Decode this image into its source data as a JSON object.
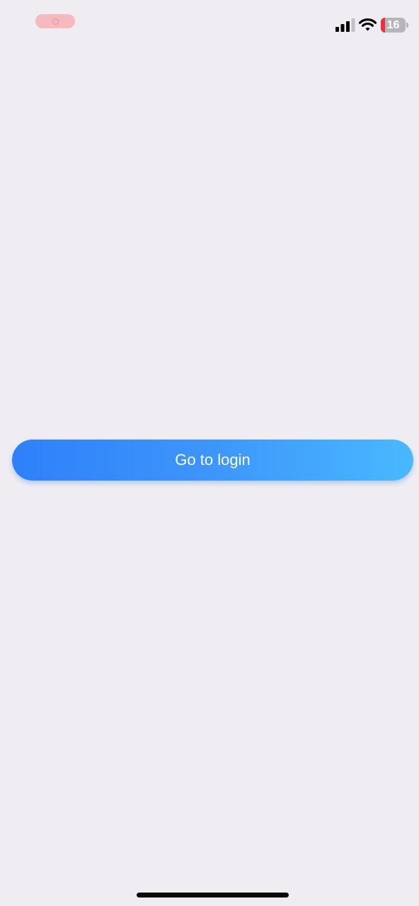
{
  "status_bar": {
    "battery_percent": 16,
    "battery_label": "16",
    "signal_bars_active": 3,
    "signal_bars_total": 4,
    "icons": [
      "screen-recording-icon",
      "cellular-signal-icon",
      "wifi-icon",
      "battery-icon"
    ],
    "colors": {
      "recording": "#f6b9bd",
      "battery_low": "#ec2f3a"
    }
  },
  "main": {
    "login_button_label": "Go to login"
  },
  "colors": {
    "background": "#efedf1",
    "button_gradient_start": "#2f80f9",
    "button_gradient_end": "#49b8ff",
    "button_text": "#ffffff"
  }
}
